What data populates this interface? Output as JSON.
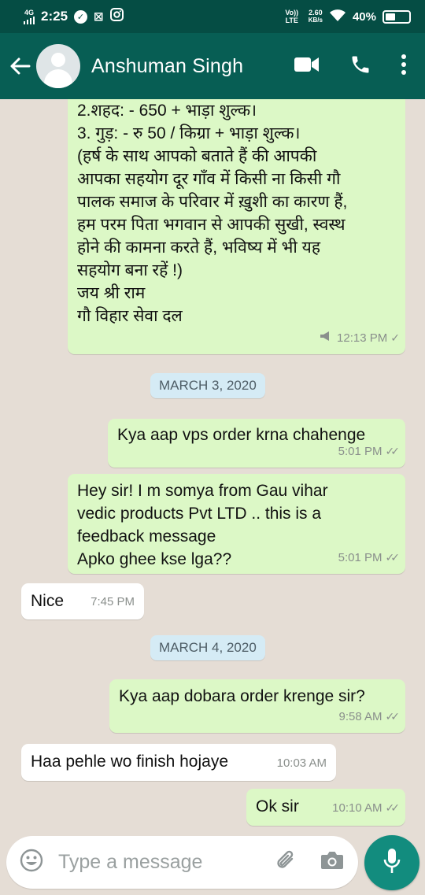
{
  "status_bar": {
    "network": "4G",
    "time": "2:25",
    "volte": "Vo)) LTE",
    "speed_value": "2.60",
    "speed_unit": "KB/s",
    "battery": "40%"
  },
  "header": {
    "contact_name": "Anshuman Singh"
  },
  "messages": [
    {
      "dir": "out",
      "text": "2.शहद: - 650 + भाड़ा शुल्क।\n3. गुड़: - रु 50 / किग्रा + भाड़ा शुल्क।\n(हर्ष के साथ आपको बताते हैं की आपकी\nआपका सहयोग दूर गाँव में किसी ना किसी गौ\nपालक समाज के परिवार में ख़ुशी का कारण हैं,\nहम परम पिता भगवान से आपकी सुखी, स्वस्थ\nहोने की कामना करते हैं, भविष्य में भी यह\nसहयोग बना रहें !)\nजय श्री राम\nगौ विहार सेवा दल",
      "time": "12:13 PM"
    },
    {
      "date": "MARCH 3, 2020"
    },
    {
      "dir": "out",
      "text": "Kya aap vps order krna chahenge",
      "time": "5:01 PM"
    },
    {
      "dir": "out",
      "text": "Hey sir! I m somya from Gau vihar\nvedic products Pvt LTD .. this is a\nfeedback message\nApko ghee kse lga??",
      "time": "5:01 PM"
    },
    {
      "dir": "in",
      "text": "Nice",
      "time": "7:45 PM"
    },
    {
      "date": "MARCH 4, 2020"
    },
    {
      "dir": "out",
      "text": "Kya aap dobara order krenge sir?",
      "time": "9:58 AM"
    },
    {
      "dir": "in",
      "text": "Haa pehle wo finish hojaye",
      "time": "10:03 AM"
    },
    {
      "dir": "out",
      "text": "Ok sir",
      "time": "10:10 AM"
    }
  ],
  "composer": {
    "placeholder": "Type a message"
  },
  "colors": {
    "header": "#075e54",
    "status_bar": "#054d44",
    "outgoing_bubble": "#dcf8c6",
    "incoming_bubble": "#ffffff",
    "date_chip": "#d5ebf5",
    "send_button": "#128c7e"
  }
}
